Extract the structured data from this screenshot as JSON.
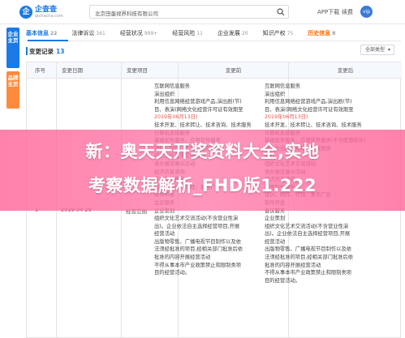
{
  "topbar": {
    "logo_mark": "企",
    "logo_name": "企查查",
    "logo_url": "qichacha.com",
    "search_value": "北京田蛋视界科技有限公司",
    "links": [
      "APP下载",
      "续费"
    ],
    "avatar": "vip"
  },
  "siderail": {
    "block_a": "企业主页",
    "block_b": "品牌主页"
  },
  "tabs": [
    {
      "label": "基本信息",
      "count": "22"
    },
    {
      "label": "法律诉讼",
      "count": "161"
    },
    {
      "label": "经营状况",
      "count": "999+"
    },
    {
      "label": "经营风险",
      "count": "11"
    },
    {
      "label": "企业发展",
      "count": "20"
    },
    {
      "label": "知识产权",
      "count": "75"
    },
    {
      "label": "历史信息",
      "count": "8"
    }
  ],
  "section": {
    "title": "变更记录",
    "count": "13",
    "filter_label": "全部类型"
  },
  "table": {
    "headers": [
      "序号",
      "变更日期",
      "变更项目",
      "变更前",
      "变更后"
    ],
    "row": {
      "index": "1",
      "date": "2019-04-29",
      "item": "经营范围"
    },
    "before_lines": [
      "互联网信息服务",
      "演出组织",
      "利用信息网络经营游戏产品,演出剧(节)",
      "目、表演(网络文化经营许可证有效期至",
      "2019年06月13日)",
      "技术开发、技术转让、技术咨询、技术服务",
      "计算机系统服务",
      "基础软件服务、应用软件服务",
      "设计、制作、代理、发布广告",
      "组织文化艺术交流活动",
      "承办展览展示活动",
      "经济贸易咨询",
      "应用软件服务",
      "设计、制作、代理、发布广告",
      "软件开发",
      "会议服务",
      "企业策划",
      "组织文化艺术交流活动(不含营业性演",
      "出)。企业依法自主选择经营项目,开展",
      "经营活动",
      "出版物零售、广播电视节目制作以及依",
      "法须经批准的项目,经相关部门批准后依",
      "批准的内容开展经营活动",
      "不得从事本市产业政策禁止和限制类项",
      "目的经营活动。"
    ],
    "after_lines": [
      "互联网信息服务",
      "演出组织",
      "利用信息网络经营游戏产品,演出剧(节)",
      "目、表演(网络文化经营许可证有效期至",
      "2019年06月13日)",
      "技术开发、技术转让、技术咨询、技术服务",
      "计算机系统服务",
      "基础软件服务、应用软件服务(不含医用软件)",
      "网络文化经营许可证有效期至",
      "中心",
      "组织文化艺术交流活动",
      "承办展览展示活动",
      "经济贸易咨询",
      "应用软件服务",
      "设计、制作、代理、发布广告",
      "软件开发",
      "会议服务",
      "企业策划",
      "组织文化艺术交流活动(不含营业性演",
      "出)。企业依法自主选择经营项目,开展",
      "经营活动",
      "出版物零售、广播电视节目制作以及依",
      "法须经批准的项目,经相关部门批准后依",
      "批准的内容开展经营活动",
      "不得从事本市产业政策禁止和限制类项",
      "目的经营活动。"
    ]
  },
  "banner": {
    "line1": "新：奥天天开奖资料大全,实地",
    "line2": "考察数据解析_FHD版1.222"
  },
  "colors": {
    "accent": "#1a79e6",
    "history_tab": "#ff6a00",
    "banner": "#ff6699"
  }
}
